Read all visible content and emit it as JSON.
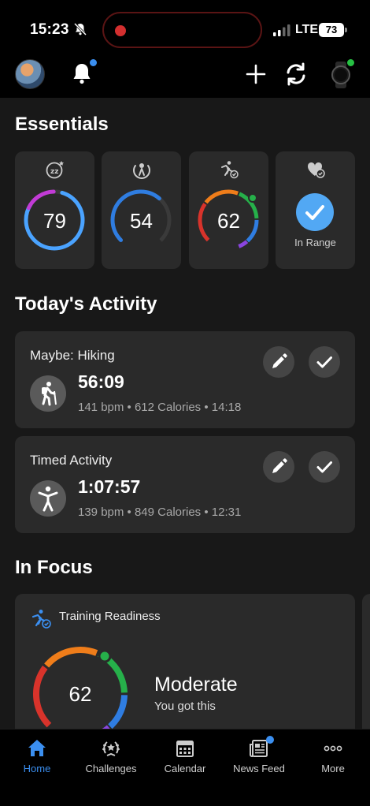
{
  "status_bar": {
    "time": "15:23",
    "network": "LTE",
    "battery": "73"
  },
  "header": {
    "icons": [
      "avatar",
      "bell-icon",
      "plus-icon",
      "sync-icon",
      "watch-icon"
    ],
    "notification_dot_color": "#3b8ff0",
    "device_dot_color": "#26c043"
  },
  "essentials": {
    "title": "Essentials",
    "cards": [
      {
        "icon": "sleep-icon",
        "value": "79",
        "level": 0.79
      },
      {
        "icon": "body-battery-icon",
        "value": "54",
        "level": 0.54
      },
      {
        "icon": "training-readiness-icon",
        "value": "62",
        "level": 0.62
      },
      {
        "icon": "heart-check-icon",
        "label": "In Range"
      }
    ]
  },
  "activity": {
    "title": "Today's Activity",
    "items": [
      {
        "title": "Maybe: Hiking",
        "icon": "hiking-icon",
        "duration": "56:09",
        "meta": "141 bpm • 612 Calories • 14:18"
      },
      {
        "title": "Timed Activity",
        "icon": "person-icon",
        "duration": "1:07:57",
        "meta": "139 bpm • 849 Calories • 12:31"
      }
    ]
  },
  "in_focus": {
    "title": "In Focus",
    "card": {
      "label": "Training Readiness",
      "value": "62",
      "status": "Moderate",
      "subtitle": "You got this"
    }
  },
  "colors": {
    "accent": "#3b8ff0",
    "card": "#2a2a2a",
    "background": "#181818"
  },
  "bottom_nav": {
    "items": [
      {
        "label": "Home",
        "icon": "home-icon",
        "active": true
      },
      {
        "label": "Challenges",
        "icon": "laurel-icon"
      },
      {
        "label": "Calendar",
        "icon": "calendar-icon"
      },
      {
        "label": "News Feed",
        "icon": "newsfeed-icon",
        "badge": true
      },
      {
        "label": "More",
        "icon": "more-icon"
      }
    ]
  }
}
